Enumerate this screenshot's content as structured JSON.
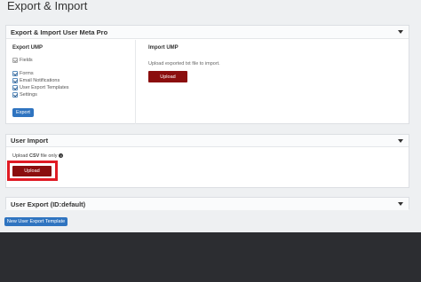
{
  "page": {
    "title": "Export & Import"
  },
  "export_import": {
    "header": "Export & Import User Meta Pro",
    "export": {
      "title": "Export UMP",
      "options": [
        {
          "label": "Fields",
          "checked": true,
          "disabled": true
        },
        {
          "label": "Forms",
          "checked": true,
          "disabled": false
        },
        {
          "label": "Email Notifications",
          "checked": true,
          "disabled": false
        },
        {
          "label": "User Export Templates",
          "checked": true,
          "disabled": false
        },
        {
          "label": "Settings",
          "checked": true,
          "disabled": false
        }
      ],
      "button_label": "Export"
    },
    "import": {
      "title": "Import UMP",
      "description": "Upload exported txt file to import.",
      "button_label": "Upload"
    }
  },
  "user_import": {
    "header": "User Import",
    "hint_prefix": "Upload ",
    "hint_bold": "CSV",
    "hint_suffix": " file only",
    "info_icon": "i",
    "button_label": "Upload"
  },
  "user_export": {
    "header": "User Export (ID:default)"
  },
  "new_template_button": "New User Export Template",
  "colors": {
    "primary_blue": "#2f74c0",
    "upload_red": "#8b0e0e",
    "highlight_red": "#e01b24",
    "footer_dark": "#2c2d31"
  }
}
